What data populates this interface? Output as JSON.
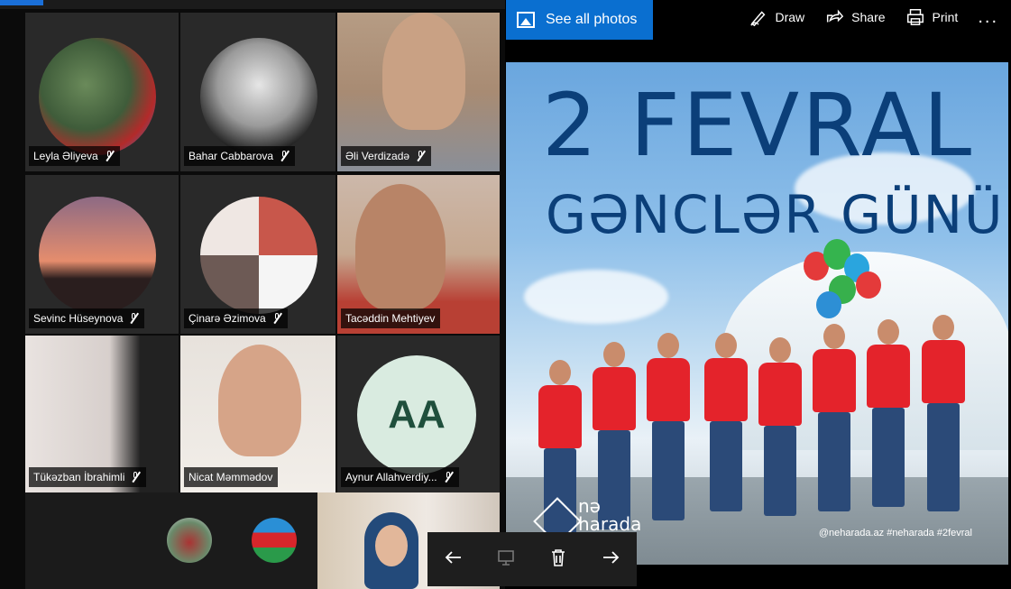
{
  "participants": [
    {
      "name": "Leyla Əliyeva",
      "muted": true
    },
    {
      "name": "Bahar Cabbarova",
      "muted": true
    },
    {
      "name": "Əli Verdizadə",
      "muted": true
    },
    {
      "name": "Sevinc Hüseynova",
      "muted": true
    },
    {
      "name": "Çinarə Əzimova",
      "muted": true
    },
    {
      "name": "Tacəddin Mehtiyev",
      "muted": false
    },
    {
      "name": "Tükəzban İbrahimli",
      "muted": true
    },
    {
      "name": "Nicat Məmmədov",
      "muted": false
    },
    {
      "name": "Aynur Allahverdiy...",
      "muted": true,
      "initials": "AA"
    }
  ],
  "viewer": {
    "see_all": "See all photos",
    "toolbar": {
      "draw": "Draw",
      "share": "Share",
      "print": "Print",
      "more": "..."
    }
  },
  "photo": {
    "headline_line1": "2 FEVRAL",
    "headline_line2": "GƏNCLƏR GÜNÜ",
    "logo_line1": "nə",
    "logo_line2": "harada",
    "hashtags": "@neharada.az #neharada #2fevral"
  },
  "colors": {
    "accent": "#0a6fd0",
    "headline": "#0b3f79",
    "shirt": "#e4232b"
  }
}
